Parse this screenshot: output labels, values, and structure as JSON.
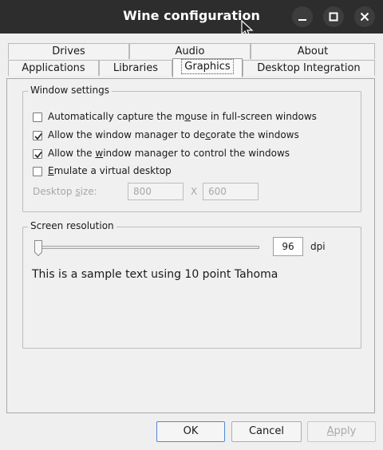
{
  "window": {
    "title": "Wine configuration"
  },
  "tabs_row1": [
    {
      "label": "Drives"
    },
    {
      "label": "Audio"
    },
    {
      "label": "About"
    }
  ],
  "tabs_row2": [
    {
      "label": "Applications"
    },
    {
      "label": "Libraries"
    },
    {
      "label": "Graphics",
      "active": true
    },
    {
      "label": "Desktop Integration"
    }
  ],
  "window_settings": {
    "legend": "Window settings",
    "options": [
      {
        "pre": "Automatically capture the m",
        "key": "o",
        "post": "use in full-screen windows",
        "checked": false
      },
      {
        "pre": "Allow the window manager to de",
        "key": "c",
        "post": "orate the windows",
        "checked": true
      },
      {
        "pre": "Allow the ",
        "key": "w",
        "post": "indow manager to control the windows",
        "checked": true
      },
      {
        "pre": "",
        "key": "E",
        "post": "mulate a virtual desktop",
        "checked": false
      }
    ],
    "desktop_size": {
      "label_pre": "Desktop ",
      "label_key": "s",
      "label_post": "ize:",
      "width": "800",
      "separator": "X",
      "height": "600"
    }
  },
  "screen_resolution": {
    "legend": "Screen resolution",
    "dpi_value": "96",
    "dpi_unit": "dpi",
    "sample_text": "This is a sample text using 10 point Tahoma"
  },
  "buttons": {
    "ok": "OK",
    "cancel": "Cancel",
    "apply_key": "A",
    "apply_post": "pply"
  }
}
